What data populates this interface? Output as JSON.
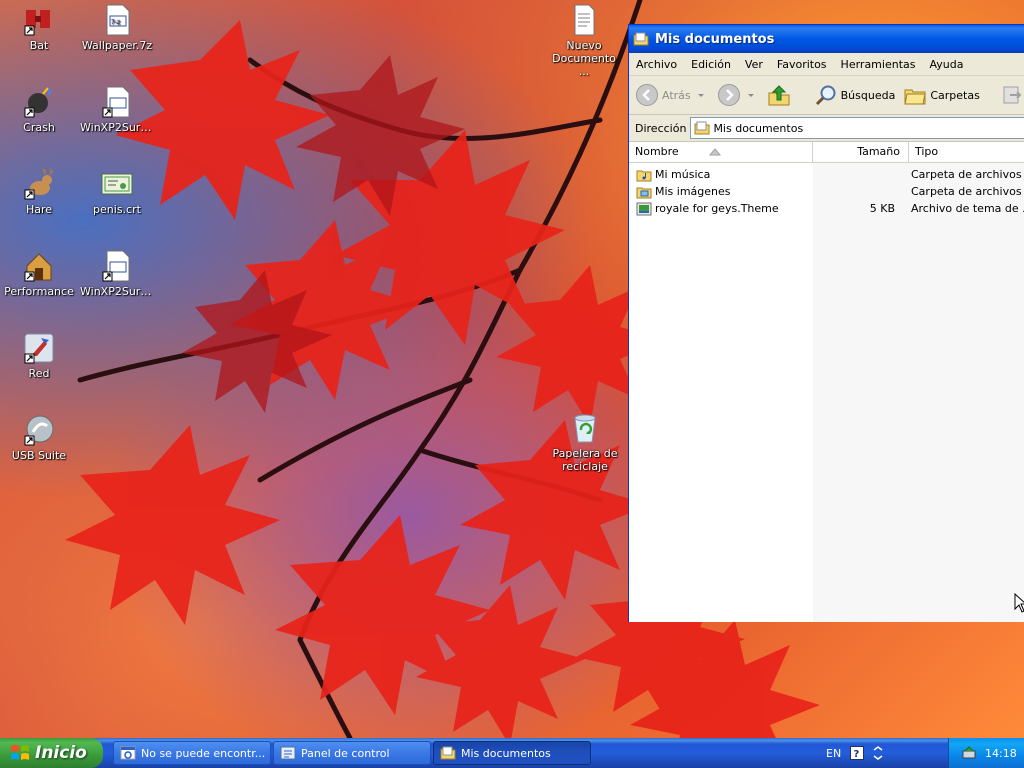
{
  "desktop": {
    "icons": [
      {
        "label": "Bat",
        "icon": "bat-shortcut-icon"
      },
      {
        "label": "Crash",
        "icon": "crash-shortcut-icon"
      },
      {
        "label": "Hare",
        "icon": "hare-shortcut-icon"
      },
      {
        "label": "Performance",
        "icon": "performance-shortcut-icon"
      },
      {
        "label": "Red",
        "icon": "red-shortcut-icon"
      },
      {
        "label": "USB Suite",
        "icon": "usb-suite-shortcut-icon"
      },
      {
        "label": "Wallpaper.7z",
        "icon": "archive-file-icon"
      },
      {
        "label": "WinXP2Suric...",
        "icon": "shortcut-file-icon"
      },
      {
        "label": "penis.crt",
        "icon": "certificate-file-icon"
      },
      {
        "label": "WinXP2Suric...",
        "icon": "shortcut-file-icon"
      },
      {
        "label": "Nuevo Documento ...",
        "icon": "text-document-icon"
      },
      {
        "label": "Papelera de reciclaje",
        "icon": "recycle-bin-icon"
      }
    ]
  },
  "window": {
    "title": "Mis documentos",
    "menu": [
      "Archivo",
      "Edición",
      "Ver",
      "Favoritos",
      "Herramientas",
      "Ayuda"
    ],
    "toolbar": {
      "back_label": "Atrás",
      "search_label": "Búsqueda",
      "folders_label": "Carpetas"
    },
    "address": {
      "label": "Dirección",
      "value": "Mis documentos"
    },
    "columns": [
      "Nombre",
      "Tamaño",
      "Tipo"
    ],
    "files": [
      {
        "name": "Mi música",
        "size": "",
        "type": "Carpeta de archivos",
        "icon": "music-folder-icon"
      },
      {
        "name": "Mis imágenes",
        "size": "",
        "type": "Carpeta de archivos",
        "icon": "pictures-folder-icon"
      },
      {
        "name": "royale for geys.Theme",
        "size": "5 KB",
        "type": "Archivo de tema de ...",
        "icon": "theme-file-icon"
      }
    ]
  },
  "taskbar": {
    "start_label": "Inicio",
    "buttons": [
      {
        "label": "No se puede encontr...",
        "icon": "ie-window-icon"
      },
      {
        "label": "Panel de control",
        "icon": "control-panel-icon"
      },
      {
        "label": "Mis documentos",
        "icon": "folder-window-icon"
      }
    ],
    "language": "EN",
    "clock": "14:18"
  },
  "colors": {
    "titlebar": "#0058e6",
    "taskbar": "#245edb",
    "start_button": "#3a9a3a",
    "window_chrome": "#ece9d8"
  }
}
